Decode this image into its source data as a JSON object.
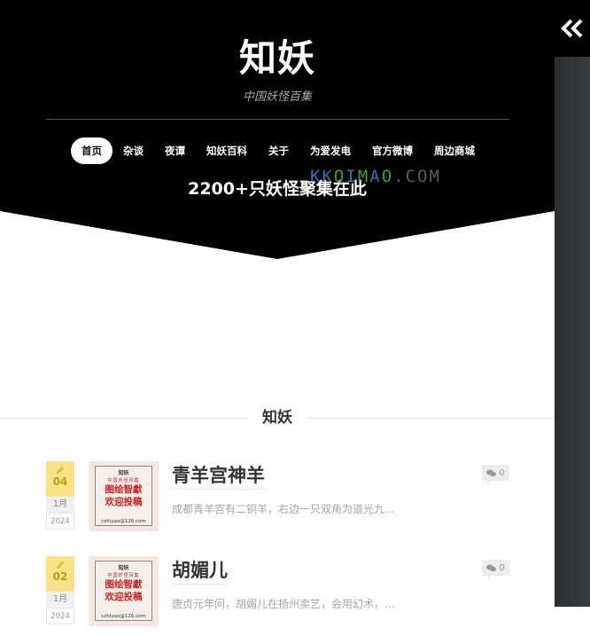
{
  "site": {
    "title": "知妖",
    "subtitle": "中国妖怪百集",
    "slogan": "2200+只妖怪聚集在此"
  },
  "watermark": {
    "text": "KKQIMAO.COM"
  },
  "nav": [
    {
      "label": "首页",
      "active": true
    },
    {
      "label": "杂谈",
      "active": false
    },
    {
      "label": "夜谭",
      "active": false
    },
    {
      "label": "知妖百科",
      "active": false
    },
    {
      "label": "关于",
      "active": false
    },
    {
      "label": "为爱发电",
      "active": false
    },
    {
      "label": "官方微博",
      "active": false
    },
    {
      "label": "周边商城",
      "active": false
    }
  ],
  "section": {
    "title": "知妖"
  },
  "posts": [
    {
      "day": "04",
      "month": "1月",
      "year": "2024",
      "title": "青羊宫神羊",
      "excerpt": "成都青羊宫有二铜羊，右边一只双角为道光九...",
      "comments": "0",
      "thumb": {
        "line1": "知妖",
        "line2": "中国妖怪百集",
        "line3a": "图绘智獻",
        "line3b": "欢迎投稿",
        "email": "czhiyao@126.com"
      }
    },
    {
      "day": "02",
      "month": "1月",
      "year": "2024",
      "title": "胡媚儿",
      "excerpt": "唐贞元年间，胡媚儿在扬州卖艺，会用幻术，...",
      "comments": "0",
      "thumb": {
        "line1": "知妖",
        "line2": "中国妖怪百集",
        "line3a": "图绘智獻",
        "line3b": "欢迎投稿",
        "email": "czhiyao@126.com"
      }
    }
  ],
  "colors": {
    "header_bg": "#000000",
    "date_accent": "#f8e389",
    "thumb_text": "#d11d1d"
  },
  "icons": {
    "collapse": "double-chevron-left-icon",
    "pencil": "pencil-icon",
    "comment": "comments-icon"
  }
}
